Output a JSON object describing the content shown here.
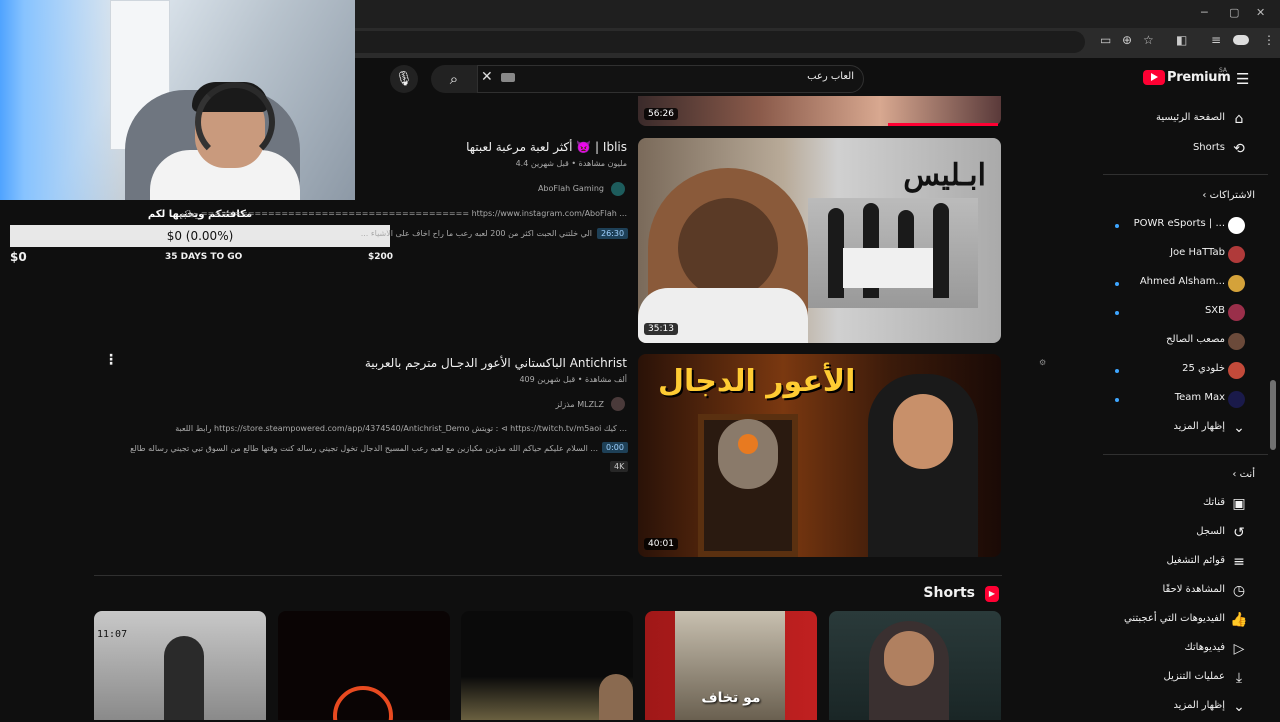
{
  "browser": {
    "window_controls": [
      "─",
      "▢",
      "✕"
    ],
    "toolbar_icons": [
      "cast-icon",
      "zoom-icon",
      "star-icon",
      "extensions-icon",
      "media-icon",
      "profile-icon",
      "menu-icon"
    ]
  },
  "webcam_overlay": {
    "donation_title": "مكافئتكم ويخبيها لكم",
    "progress_text": "$0 (0.00%)",
    "progress_fraction": 0.0,
    "min_label": "$0",
    "days_label": "35 DAYS TO GO",
    "max_label": "$200"
  },
  "header": {
    "search_query": "العاب رعب",
    "logo_text": "Premium",
    "region": "SA"
  },
  "videos": [
    {
      "title": "أكثر لعبة مرعبة لعبتها 👿 | Iblis",
      "meta": "4.4 مليون مشاهدة • قبل شهرين",
      "channel": "AboFlah Gaming",
      "desc1": "حياكم ======================================== https://www.instagram.com/AboFlah ...",
      "chip": "26:30",
      "desc2": "... الي خلتني الحبت اكثر من 200 لعبه رعب ما راح اخاف على الاشياء",
      "duration": "35:13",
      "thumb_text": "ابـليس"
    },
    {
      "title": "الباكستاني الأعور الدجـال مترجم بالعربية Antichrist",
      "meta": "409 ألف مشاهدة • قبل شهرين",
      "channel": "مذزلز MLZLZ",
      "desc1": "رابط اللعبة https://store.steampowered.com/app/4374540/Antichrist_Demo تويتش : ⊲ https://twitch.tv/m5aoi كيك ...",
      "chip": "0:00",
      "desc2": "السلام عليكم حياكم الله مذزين مكيازين مع لعبه رعب المسيح الدجال تخول تجيني رساله كنت وقتها طالع من السوق تبي تجيني رساله طالع ...",
      "badge": "4K",
      "duration": "40:01",
      "thumb_text": "الأعور الدجال"
    }
  ],
  "top_video_duration": "56:26",
  "shorts": {
    "title": "Shorts",
    "items": [
      {
        "overlay": "11:07"
      },
      {
        "overlay": ""
      },
      {
        "overlay": ""
      },
      {
        "overlay": "مو تخاف"
      },
      {
        "overlay": ""
      }
    ]
  },
  "sidebar": {
    "main": [
      {
        "label": "الصفحة الرئيسية",
        "icon": "home-icon"
      },
      {
        "label": "Shorts",
        "icon": "shorts-icon"
      }
    ],
    "subs_header": "الاشتراكات",
    "subscriptions": [
      {
        "label": "POWR eSports | ...",
        "color": "#ffffff"
      },
      {
        "label": "Joe HaTTab",
        "color": "#b03a3a"
      },
      {
        "label": "Ahmed Alsham...",
        "color": "#d4a23a"
      },
      {
        "label": "SXB",
        "color": "#9a2f4a"
      },
      {
        "label": "مصعب الصالح",
        "color": "#6b4a3a"
      },
      {
        "label": "خلودي 25",
        "color": "#c24a3a"
      },
      {
        "label": "Team Max",
        "color": "#1a1a4a"
      }
    ],
    "show_more": "إظهار المزيد",
    "you_header": "أنت",
    "you_items": [
      {
        "label": "قناتك",
        "icon": "channel-icon"
      },
      {
        "label": "السجل",
        "icon": "history-icon"
      },
      {
        "label": "قوائم التشغيل",
        "icon": "playlists-icon"
      },
      {
        "label": "المشاهدة لاحقًا",
        "icon": "watch-later-icon"
      },
      {
        "label": "الفيديوهات التي أعجبتني",
        "icon": "liked-icon"
      },
      {
        "label": "فيديوهاتك",
        "icon": "your-videos-icon"
      },
      {
        "label": "عمليات التنزيل",
        "icon": "downloads-icon"
      },
      {
        "label": "إظهار المزيد",
        "icon": "chevron-down-icon"
      }
    ]
  }
}
